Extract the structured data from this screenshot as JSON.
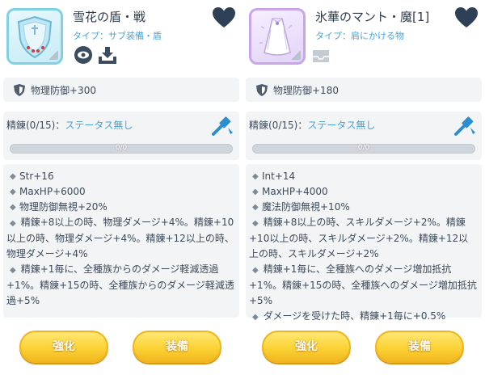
{
  "colors": {
    "accent_blue": "#4aa3d8",
    "heart": "#2e4055",
    "button_yellow": "#fbd235",
    "card_bg": "#f2f4f6",
    "icon_border_blue": "#7fd2e6",
    "icon_border_purple": "#c9a6ec"
  },
  "left": {
    "name": "雪花の盾・戦",
    "type": "タイプ：サブ装備・盾",
    "defense": "物理防御+300",
    "refine_label": "精錬(0/15)：",
    "refine_status": "ステータス無し",
    "progress_text": "0/0",
    "progress_fraction": 0,
    "stats": [
      "Str+16",
      "MaxHP+6000",
      "物理防御無視+20%"
    ],
    "paragraphs": [
      "精錬+8以上の時、物理ダメージ+4%。精錬+10以上の時、物理ダメージ+4%。精錬+12以上の時、物理ダメージ+4%",
      "精錬+1毎に、全種族からのダメージ軽減透過+1%。精錬+15の時、全種族からのダメージ軽減透過+5%"
    ],
    "icons": [
      "shield-item-icon",
      "heart-icon",
      "eye-icon",
      "download-icon",
      "shield-icon",
      "hammer-icon"
    ],
    "buttons": {
      "enhance": "強化",
      "equip": "装備"
    }
  },
  "right": {
    "name": "氷華のマント・魔[1]",
    "type": "タイプ：肩にかける物",
    "defense": "物理防御+180",
    "refine_label": "精錬(0/15)：",
    "refine_status": "ステータス無し",
    "progress_text": "0/0",
    "progress_fraction": 0,
    "stats": [
      "Int+14",
      "MaxHP+4000",
      "魔法防御無視+10%"
    ],
    "paragraphs": [
      "精錬+8以上の時、スキルダメージ+2%。精錬+10以上の時、スキルダメージ+2%。精錬+12以上の時、スキルダメージ+2%",
      "精錬+1毎に、全種族へのダメージ増加抵抗+1%。精錬+15の時、全種族へのダメージ増加抵抗+5%",
      "ダメージを受けた時、精錬+1毎に+0.5%"
    ],
    "icons": [
      "cape-item-icon",
      "heart-icon",
      "tray-icon",
      "shield-icon",
      "hammer-icon"
    ],
    "buttons": {
      "enhance": "強化",
      "equip": "装備"
    }
  }
}
